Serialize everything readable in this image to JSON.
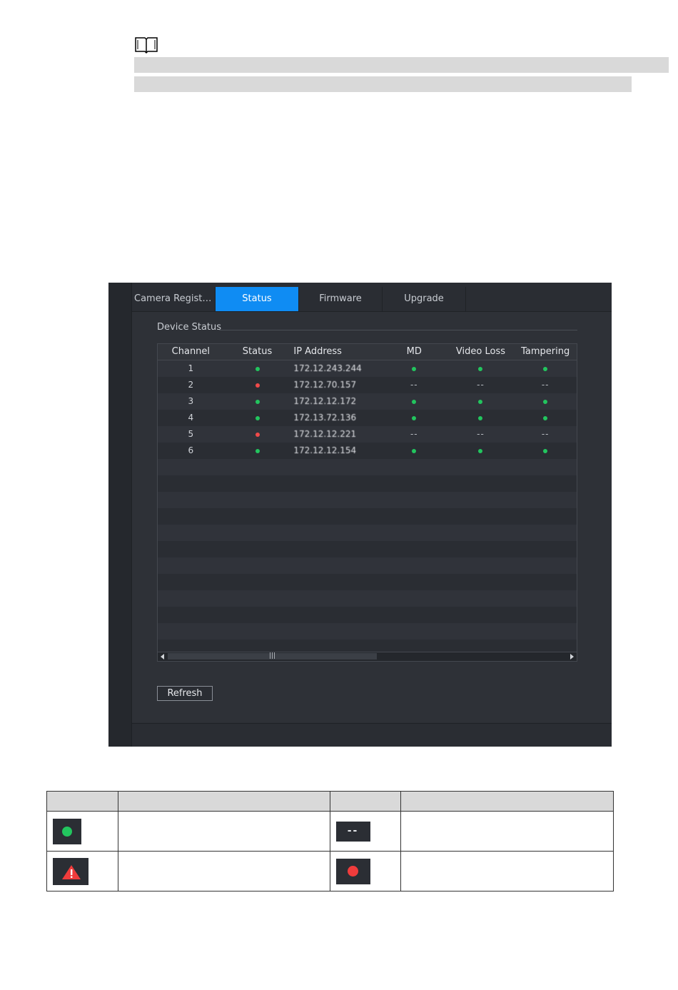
{
  "panel": {
    "tabs": [
      {
        "label": "Camera Registr...",
        "active": false
      },
      {
        "label": "Status",
        "active": true
      },
      {
        "label": "Firmware",
        "active": false
      },
      {
        "label": "Upgrade",
        "active": false
      }
    ],
    "section_title": "Device Status",
    "columns": [
      "Channel",
      "Status",
      "IP Address",
      "MD",
      "Video Loss",
      "Tampering"
    ],
    "rows": [
      {
        "channel": "1",
        "status": "ok",
        "ip": "172.12.243.244",
        "md": "ok",
        "video_loss": "ok",
        "tampering": "ok"
      },
      {
        "channel": "2",
        "status": "err",
        "ip": "172.12.70.157",
        "md": "--",
        "video_loss": "--",
        "tampering": "--"
      },
      {
        "channel": "3",
        "status": "ok",
        "ip": "172.12.12.172",
        "md": "ok",
        "video_loss": "ok",
        "tampering": "ok"
      },
      {
        "channel": "4",
        "status": "ok",
        "ip": "172.13.72.136",
        "md": "ok",
        "video_loss": "ok",
        "tampering": "ok"
      },
      {
        "channel": "5",
        "status": "err",
        "ip": "172.12.12.221",
        "md": "--",
        "video_loss": "--",
        "tampering": "--"
      },
      {
        "channel": "6",
        "status": "ok",
        "ip": "172.12.12.154",
        "md": "ok",
        "video_loss": "ok",
        "tampering": "ok"
      }
    ],
    "empty_rows": 12,
    "refresh_label": "Refresh",
    "scroll_grip": "|||"
  },
  "legend": {
    "dash_symbol": "--",
    "colors": {
      "ok": "#22c55e",
      "alarm": "#f03c3c",
      "accent": "#0f8cf3"
    }
  }
}
